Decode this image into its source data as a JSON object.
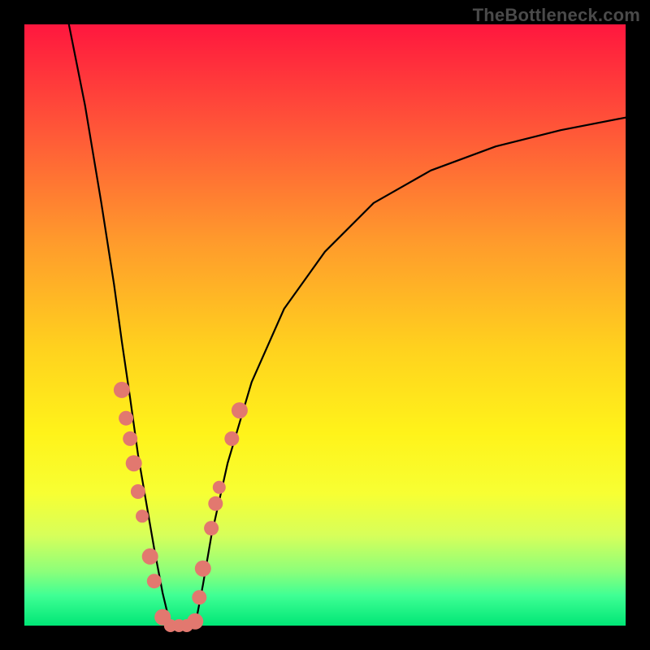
{
  "watermark": "TheBottleneck.com",
  "colors": {
    "background": "#000000",
    "gradient_top": "#ff173e",
    "gradient_bottom": "#00e676",
    "curve": "#000000",
    "marker": "#e2786f"
  },
  "chart_data": {
    "type": "line",
    "title": "",
    "xlabel": "",
    "ylabel": "",
    "xlim": [
      0,
      100
    ],
    "ylim": [
      0,
      100
    ],
    "grid": false,
    "legend": false,
    "notes": "V-shaped bottleneck curve on red→green gradient; trough near x≈25, y≈0. Values estimated from pixel positions (no axis labels present).",
    "series": [
      {
        "name": "left-branch",
        "x": [
          7.4,
          10.1,
          12.8,
          14.9,
          16.2,
          17.6,
          18.9,
          20.3,
          21.6,
          23.0,
          24.3
        ],
        "y": [
          100.0,
          86.5,
          70.3,
          56.8,
          47.3,
          37.8,
          28.4,
          20.3,
          12.8,
          5.4,
          0.0
        ]
      },
      {
        "name": "trough",
        "x": [
          24.3,
          25.7,
          27.0,
          28.4
        ],
        "y": [
          0.0,
          0.0,
          0.0,
          0.0
        ]
      },
      {
        "name": "right-branch",
        "x": [
          28.4,
          29.7,
          31.1,
          33.8,
          37.8,
          43.2,
          50.0,
          58.1,
          67.6,
          78.4,
          89.2,
          100.0
        ],
        "y": [
          0.0,
          6.8,
          14.9,
          27.0,
          40.5,
          52.7,
          62.2,
          70.3,
          75.7,
          79.7,
          82.4,
          84.5
        ]
      }
    ],
    "markers": {
      "name": "highlighted-points",
      "color": "#e2786f",
      "points": [
        {
          "x": 16.2,
          "y": 39.2,
          "r": 10
        },
        {
          "x": 16.9,
          "y": 34.5,
          "r": 9
        },
        {
          "x": 17.6,
          "y": 31.1,
          "r": 9
        },
        {
          "x": 18.2,
          "y": 27.0,
          "r": 10
        },
        {
          "x": 18.9,
          "y": 22.3,
          "r": 9
        },
        {
          "x": 19.6,
          "y": 18.2,
          "r": 8
        },
        {
          "x": 20.9,
          "y": 11.5,
          "r": 10
        },
        {
          "x": 21.6,
          "y": 7.4,
          "r": 9
        },
        {
          "x": 23.0,
          "y": 1.4,
          "r": 10
        },
        {
          "x": 24.3,
          "y": 0.0,
          "r": 8
        },
        {
          "x": 25.7,
          "y": 0.0,
          "r": 8
        },
        {
          "x": 27.0,
          "y": 0.0,
          "r": 8
        },
        {
          "x": 28.4,
          "y": 0.7,
          "r": 10
        },
        {
          "x": 29.1,
          "y": 4.7,
          "r": 9
        },
        {
          "x": 29.7,
          "y": 9.5,
          "r": 10
        },
        {
          "x": 31.1,
          "y": 16.2,
          "r": 9
        },
        {
          "x": 31.8,
          "y": 20.3,
          "r": 9
        },
        {
          "x": 32.4,
          "y": 23.0,
          "r": 8
        },
        {
          "x": 34.5,
          "y": 31.1,
          "r": 9
        },
        {
          "x": 35.8,
          "y": 35.8,
          "r": 10
        }
      ]
    }
  }
}
